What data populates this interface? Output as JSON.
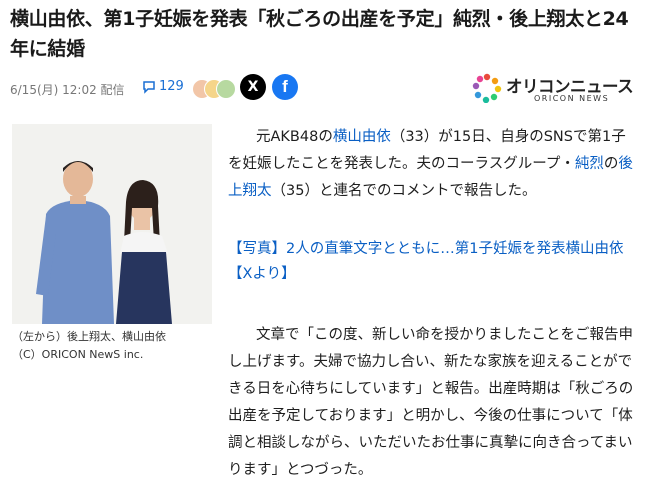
{
  "article": {
    "headline": "横山由依、第1子妊娠を発表「秋ごろの出産を予定」純烈・後上翔太と24年に結婚",
    "date": "6/15(月) 12:02 配信",
    "comment_count": "129"
  },
  "share": {
    "x_label": "X",
    "facebook_label": "f"
  },
  "logo": {
    "name": "オリコンニュース",
    "sub": "ORICON NEWS"
  },
  "photo": {
    "caption_line1": "（左から）後上翔太、横山由依",
    "caption_line2": "（C）ORICON NewS inc."
  },
  "body": {
    "p1_pre": "元AKB48の",
    "p1_link1": "横山由依",
    "p1_mid": "（33）が15日、自身のSNSで第1子を妊娠したことを発表した。夫のコーラスグループ・",
    "p1_link2": "純烈",
    "p1_mid2": "の",
    "p1_link3": "後上翔太",
    "p1_post": "（35）と連名でのコメントで報告した。",
    "photo_link": "【写真】2人の直筆文字とともに…第1子妊娠を発表横山由依【Xより】",
    "p2": "文章で「この度、新しい命を授かりましたことをご報告申し上げます。夫婦で協力し合い、新たな家族を迎えることができる日を心待ちにしています」と報告。出産時期は「秋ごろの出産を予定しております」と明かし、今後の仕事について「体調と相談しながら、いただいたお仕事に真摯に向き合ってまいります」とつづった。"
  },
  "colors": {
    "link": "#0a5fc4",
    "accent_blue": "#1a6fd4",
    "facebook": "#1877f2"
  }
}
